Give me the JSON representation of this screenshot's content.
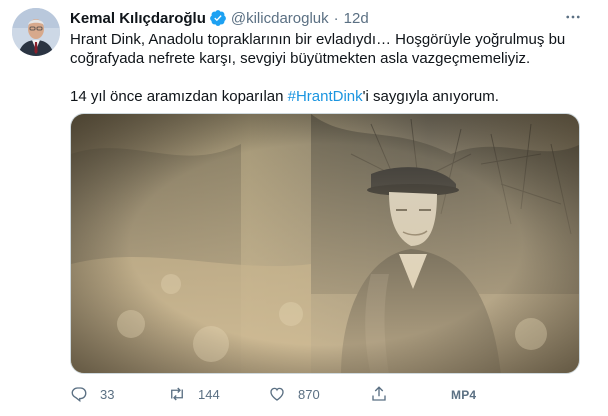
{
  "author": {
    "name": "Kemal Kılıçdaroğlu",
    "handle": "@kilicdarogluk",
    "separator": "·",
    "time": "12d"
  },
  "tweet": {
    "line1": "Hrant Dink, Anadolu topraklarının bir evladıydı… Hoşgörüyle yoğrulmuş bu",
    "line2": "coğrafyada nefrete karşı, sevgiyi büyütmekten asla vazgeçmemeliyiz.",
    "line3_before": "14 yıl önce aramızdan koparılan ",
    "hashtag": "#HrantDink",
    "line3_after": "'i saygıyla anıyorum."
  },
  "actions": {
    "replies": "33",
    "retweets": "144",
    "likes": "870",
    "media_label": "MP4"
  },
  "icons": {
    "verified": "verified-badge-icon",
    "more": "more-options-icon",
    "reply": "reply-icon",
    "retweet": "retweet-icon",
    "like": "heart-icon",
    "share": "share-icon"
  },
  "colors": {
    "link": "#1b95e0",
    "secondary_text": "#5b7083",
    "verified": "#1da1f2"
  }
}
